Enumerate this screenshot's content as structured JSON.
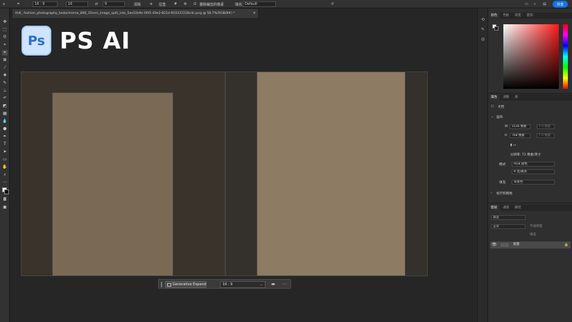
{
  "options_bar": {
    "ratio_preset": "16 : 9",
    "width_value": "16",
    "height_value": "9",
    "clear_label": "清除",
    "straighten_label": "拉直",
    "delete_cropped_label": "删除裁剪的像素",
    "fill_label": "填充",
    "fill_value": "Default",
    "share_label": "共享"
  },
  "document_tab": {
    "title": "thill_ fashion_photography_kodachrome_800_35mm_image_split_into_5ae10e9c-00f1-49e2-821d-910337228c4c.png @ 58.7%(RGB/8#) *",
    "close": "×"
  },
  "branding": {
    "logo_text": "Ps",
    "title": "PS AI"
  },
  "contextual_taskbar": {
    "generative_expand_label": "Generative Expand",
    "ratio_value": "16 : 9",
    "chevron": "⌄"
  },
  "panels": {
    "top_tabs": [
      "颜色",
      "色板",
      "渐变",
      "图案"
    ],
    "props_tabs": [
      "属性",
      "调整",
      "库"
    ],
    "doc_label": "文档",
    "canvas_section": "画布",
    "width_label": "W",
    "width_value": "1536 像素",
    "width_y": "Y 0 像素",
    "height_label": "H",
    "height_value": "768 像素",
    "height_y": "Y 0 像素",
    "resolution_label": "分辨率: 72 像素/英寸",
    "mode_label": "模式",
    "mode_value": "RGB 颜色",
    "depth_value": "8 位/通道",
    "fill_label": "填充",
    "fill_value": "背景色",
    "rulers_section": "标尺和网格",
    "layer_tabs": [
      "图层",
      "通道",
      "路径"
    ],
    "kind_filter": "类型",
    "blend_mode": "正常",
    "opacity_label": "不透明度",
    "fill_opacity_label": "填充",
    "layer_name": "背景"
  },
  "colors": {
    "accent": "#1473e6",
    "panel_bg": "#2f2f2f",
    "workspace_bg": "#262626"
  }
}
